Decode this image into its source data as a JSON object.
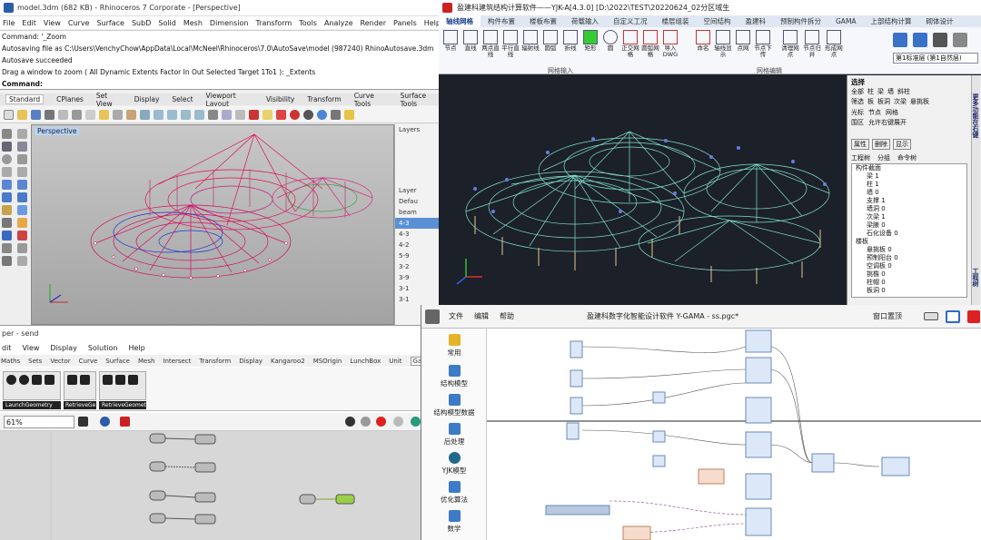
{
  "rhino": {
    "title": "model.3dm (682 KB) - Rhinoceros 7 Corporate - [Perspective]",
    "menu": [
      "File",
      "Edit",
      "View",
      "Curve",
      "Surface",
      "SubD",
      "Solid",
      "Mesh",
      "Dimension",
      "Transform",
      "Tools",
      "Analyze",
      "Render",
      "Panels",
      "Help"
    ],
    "command_history": [
      "Command: '_Zoom",
      "Autosaving file as C:\\Users\\VenchyChow\\AppData\\Local\\McNeel\\Rhinoceros\\7.0\\AutoSave\\model (987240) RhinoAutosave.3dm",
      "Autosave succeeded",
      "Drag a window to zoom ( All  Dynamic  Extents  Factor  In  Out  Selected  Target  1To1 ): _Extents"
    ],
    "command_prompt": "Command:",
    "toolbar_tabs": [
      "Standard",
      "CPlanes",
      "Set View",
      "Display",
      "Select",
      "Viewport Layout",
      "Visibility",
      "Transform",
      "Curve Tools",
      "Surface Tools"
    ],
    "viewport_label": "Perspective",
    "layers_panel_title": "Layers",
    "layer_header": "Layer",
    "layers": [
      "Defau",
      "beam",
      "4-3",
      "4-3",
      "4-2",
      "5-9",
      "3-2",
      "3-9",
      "3-1",
      "3-1"
    ]
  },
  "yjk": {
    "title": "盈建科建筑结构计算软件——YJK-A[4.3.0]    [D:\\2022\\TEST\\20220624_02分区域生",
    "tabs": [
      "轴线网格",
      "构件布置",
      "楼板布置",
      "荷载输入",
      "自定义工况",
      "楼层组装",
      "空间结构",
      "盈建科",
      "预制构件拆分",
      "GAMA",
      "上部结构计算",
      "砌体设计"
    ],
    "active_tab": 0,
    "ribbon_tools": [
      "节点",
      "直线",
      "两点直线",
      "平行直线",
      "辐射线",
      "圆弧",
      "折线",
      "矩形",
      "圆",
      "正交网格",
      "圆弧网格",
      "导入DWG",
      "命名",
      "轴线显示",
      "点网",
      "节点下传",
      "清理网点",
      "节点归并",
      "形成网点"
    ],
    "group_labels": [
      "网格输入",
      "网格编辑"
    ],
    "floor_select": "第1标准层 (第1自然层)",
    "select_title": "选择",
    "select_options": [
      "全部",
      "柱",
      "梁",
      "墙",
      "斜柱",
      "筛选",
      "板",
      "板洞",
      "次梁",
      "悬挑板",
      "光标",
      "节点",
      "网格",
      "围区",
      "允许右键展开"
    ],
    "panel_buttons": [
      "属性",
      "删除",
      "显示"
    ],
    "tree_tabs": [
      "工程树",
      "分组",
      "命令树"
    ],
    "tree_items": [
      "构件截面",
      "梁 1",
      "柱 1",
      "墙 0",
      "支撑 1",
      "墙洞 0",
      "次梁 1",
      "梁腋 0",
      "石化设备 0",
      "楼板",
      "悬挑板 0",
      "预制阳台 0",
      "空调板 0",
      "挑檐 0",
      "柱帽 0",
      "板洞 0"
    ],
    "side_label": "工程树",
    "side_label2": "更多功能在右键"
  },
  "grasshopper": {
    "title": "per - send",
    "menu": [
      "dit",
      "View",
      "Display",
      "Solution",
      "Help"
    ],
    "tabs": [
      "Maths",
      "Sets",
      "Vector",
      "Curve",
      "Surface",
      "Mesh",
      "Intersect",
      "Transform",
      "Display",
      "Kangaroo2",
      "MSOrigin",
      "LunchBox",
      "Unit",
      "Gama"
    ],
    "active_tab": "Gama",
    "comp_groups": [
      "LaunchGeometry",
      "RetrieveGe...",
      "RetrieveGeometry"
    ],
    "zoom": "61%"
  },
  "gama": {
    "title": "盈建科数字化智能设计软件 Y-GAMA - ss.pgc*",
    "menu": [
      "文件",
      "编辑",
      "帮助"
    ],
    "window_label": "窗口置顶",
    "sidebar": [
      "常用",
      "结构模型",
      "结构模型数据",
      "后处理",
      "YJK模型",
      "优化算法",
      "数学"
    ]
  }
}
